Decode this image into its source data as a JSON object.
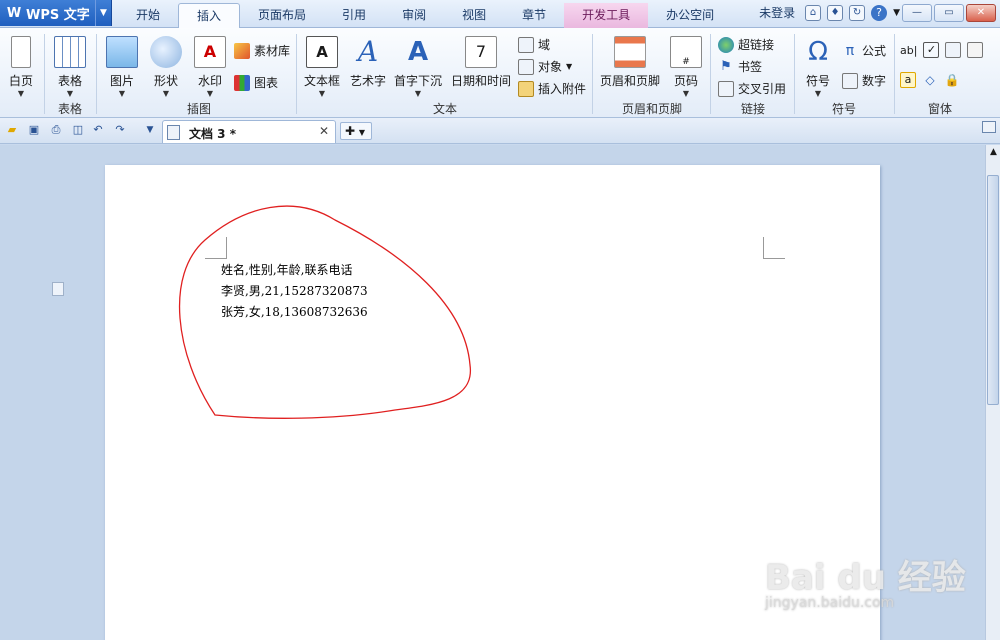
{
  "app": {
    "title": "WPS 文字",
    "logo": "W"
  },
  "menu": {
    "tabs": [
      "开始",
      "插入",
      "页面布局",
      "引用",
      "审阅",
      "视图",
      "章节",
      "开发工具",
      "办公空间"
    ],
    "active_tab": "插入",
    "login": "未登录"
  },
  "ribbon": {
    "partial_label": "白页",
    "table": "表格",
    "picture": "图片",
    "shape": "形状",
    "watermark": "水印",
    "material": "素材库",
    "chart": "图表",
    "textbox": "文本框",
    "wordart": "艺术字",
    "dropcap": "首字下沉",
    "datetime": "日期和时间",
    "field": "域",
    "object": "对象",
    "attachment": "插入附件",
    "header_footer": "页眉和页脚",
    "page_number": "页码",
    "hyperlink": "超链接",
    "bookmark": "书签",
    "crossref": "交叉引用",
    "symbol": "符号",
    "formula": "公式",
    "number": "数字",
    "groups": {
      "table": "表格",
      "illustration": "插图",
      "text": "文本",
      "header_footer": "页眉和页脚",
      "link": "链接",
      "symbol": "符号",
      "form": "窗体"
    },
    "form_text": "ab|"
  },
  "docbar": {
    "doc_title": "文档 3 *"
  },
  "document": {
    "lines": [
      "姓名,性别,年龄,联系电话",
      "李贤,男,21,15287320873",
      "张芳,女,18,13608732636"
    ]
  },
  "watermark": {
    "brand": "Bai du 经验",
    "url": "jingyan.baidu.com"
  }
}
